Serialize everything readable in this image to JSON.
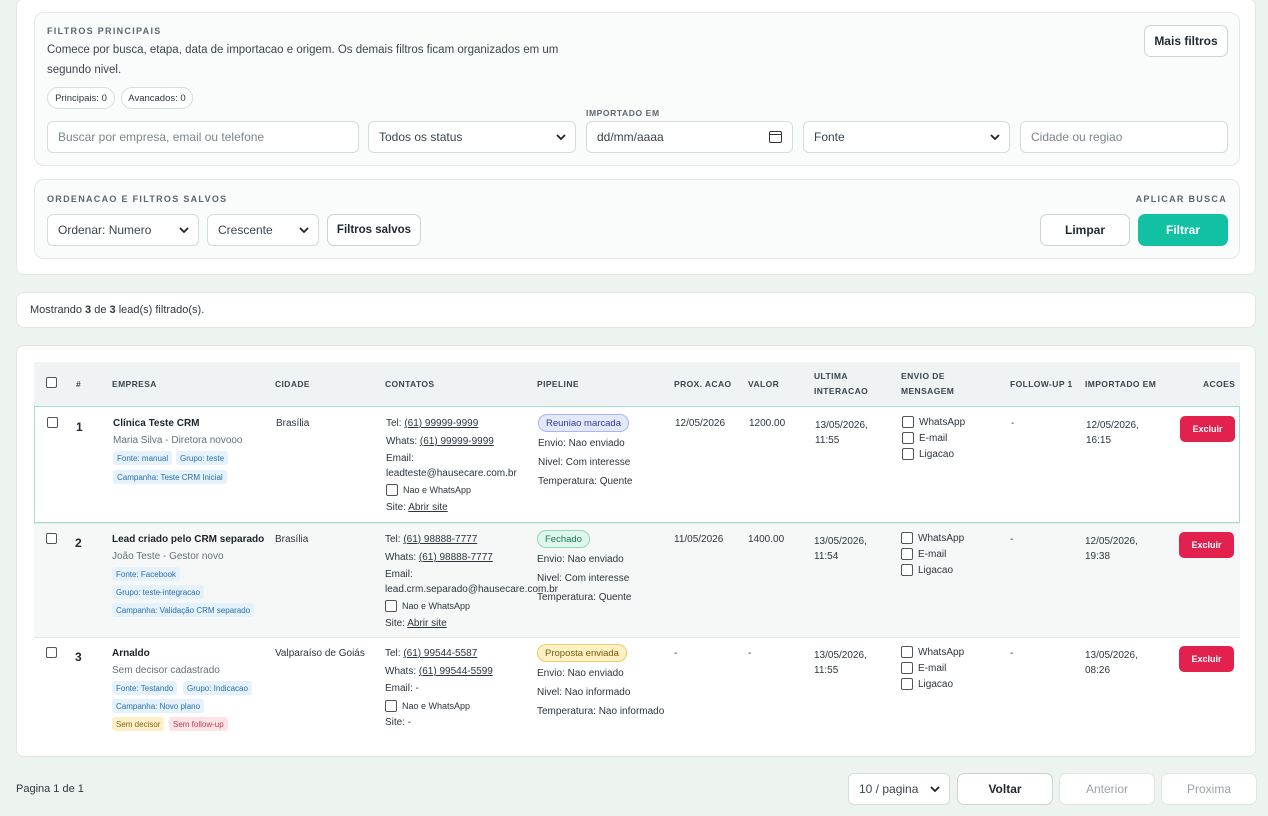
{
  "filters": {
    "title": "FILTROS PRINCIPAIS",
    "description_line1": "Comece por busca, etapa, data de importacao e origem. Os demais filtros ficam organizados em um",
    "description_line2": "segundo nivel.",
    "more_filters_label": "Mais filtros",
    "pill_principais": "Principais: 0",
    "pill_avancados": "Avancados: 0",
    "search_placeholder": "Buscar por empresa, email ou telefone",
    "status_value": "Todos os status",
    "imported_label": "IMPORTADO EM",
    "date_placeholder": "dd/mm/aaaa",
    "source_value": "Fonte",
    "city_placeholder": "Cidade ou regiao"
  },
  "sorting": {
    "title": "ORDENACAO E FILTROS SALVOS",
    "apply_title": "APLICAR BUSCA",
    "order_value": "Ordenar: Numero",
    "direction_value": "Crescente",
    "saved_filters_label": "Filtros salvos",
    "clear_label": "Limpar",
    "filter_label": "Filtrar"
  },
  "summary": {
    "prefix": "Mostrando ",
    "shown": "3",
    "middle": " de ",
    "total": "3",
    "suffix": " lead(s) filtrado(s)."
  },
  "table": {
    "headers": {
      "num": "#",
      "empresa": "EMPRESA",
      "cidade": "CIDADE",
      "contatos": "CONTATOS",
      "pipeline": "PIPELINE",
      "prox": "PROX. ACAO",
      "valor": "VALOR",
      "ultima1": "ULTIMA",
      "ultima2": "INTERACAO",
      "envio1": "ENVIO DE",
      "envio2": "MENSAGEM",
      "followup": "FOLLOW-UP 1",
      "importado": "IMPORTADO EM",
      "acoes": "ACOES"
    },
    "rows": [
      {
        "num": "1",
        "empresa": "Clínica Teste CRM",
        "contact_person": "Maria Silva - Diretora novooo",
        "tags": [
          "Fonte: manual",
          "Grupo: teste",
          "Campanha: Teste CRM Inicial"
        ],
        "cidade": "Brasília",
        "tel_label": "Tel: ",
        "tel": "(61) 99999-9999",
        "whats_label": "Whats: ",
        "whats": "(61) 99999-9999",
        "email_label": "Email:",
        "email": "leadteste@hausecare.com.br",
        "nao_whatsapp": "Nao e WhatsApp",
        "site_label": "Site: ",
        "site": "Abrir site",
        "stage": "Reuniao marcada",
        "envio": "Envio: Nao enviado",
        "nivel": "Nivel: Com interesse",
        "temperatura": "Temperatura: Quente",
        "prox": "12/05/2026",
        "valor": "1200.00",
        "ultima1": "13/05/2026,",
        "ultima2": "11:55",
        "followup": "-",
        "importado1": "12/05/2026,",
        "importado2": "16:15",
        "excluir": "Excluir"
      },
      {
        "num": "2",
        "empresa": "Lead criado pelo CRM separado",
        "contact_person": "João Teste - Gestor novo",
        "tags": [
          "Fonte: Facebook",
          "Grupo: teste-integracao",
          "Campanha: Validação CRM separado"
        ],
        "cidade": "Brasília",
        "tel_label": "Tel: ",
        "tel": "(61) 98888-7777",
        "whats_label": "Whats: ",
        "whats": "(61) 98888-7777",
        "email_label": "Email:",
        "email": "lead.crm.separado@hausecare.com.br",
        "nao_whatsapp": "Nao e WhatsApp",
        "site_label": "Site: ",
        "site": "Abrir site",
        "stage": "Fechado",
        "envio": "Envio: Nao enviado",
        "nivel": "Nivel: Com interesse",
        "temperatura": "Temperatura: Quente",
        "prox": "11/05/2026",
        "valor": "1400.00",
        "ultima1": "13/05/2026,",
        "ultima2": "11:54",
        "followup": "-",
        "importado1": "12/05/2026,",
        "importado2": "19:38",
        "excluir": "Excluir"
      },
      {
        "num": "3",
        "empresa": "Arnaldo",
        "contact_person": "Sem decisor cadastrado",
        "tags": [
          "Fonte: Testando",
          "Grupo: Indicacao",
          "Campanha: Novo plano"
        ],
        "alert_tags": [
          "Sem decisor",
          "Sem follow-up"
        ],
        "cidade": "Valparaíso de Goiás",
        "tel_label": "Tel: ",
        "tel": "(61) 99544-5587",
        "whats_label": "Whats: ",
        "whats": "(61) 99544-5599",
        "email_label": "Email: -",
        "email": "",
        "nao_whatsapp": "Nao e WhatsApp",
        "site_label": "Site: -",
        "site": "",
        "stage": "Proposta enviada",
        "envio": "Envio: Nao enviado",
        "nivel": "Nivel: Nao informado",
        "temperatura": "Temperatura: Nao informado",
        "prox": "-",
        "valor": "-",
        "ultima1": "13/05/2026,",
        "ultima2": "11:55",
        "followup": "-",
        "importado1": "13/05/2026,",
        "importado2": "08:26",
        "excluir": "Excluir"
      }
    ],
    "message_channels": [
      "WhatsApp",
      "E-mail",
      "Ligacao"
    ]
  },
  "pagination": {
    "page_text": "Pagina 1 de 1",
    "per_page": "10 / pagina",
    "back_label": "Voltar",
    "prev_label": "Anterior",
    "next_label": "Proxima"
  },
  "colors": {
    "accent": "#12c1a3",
    "danger": "#e3214e",
    "background": "#edf4f0"
  }
}
